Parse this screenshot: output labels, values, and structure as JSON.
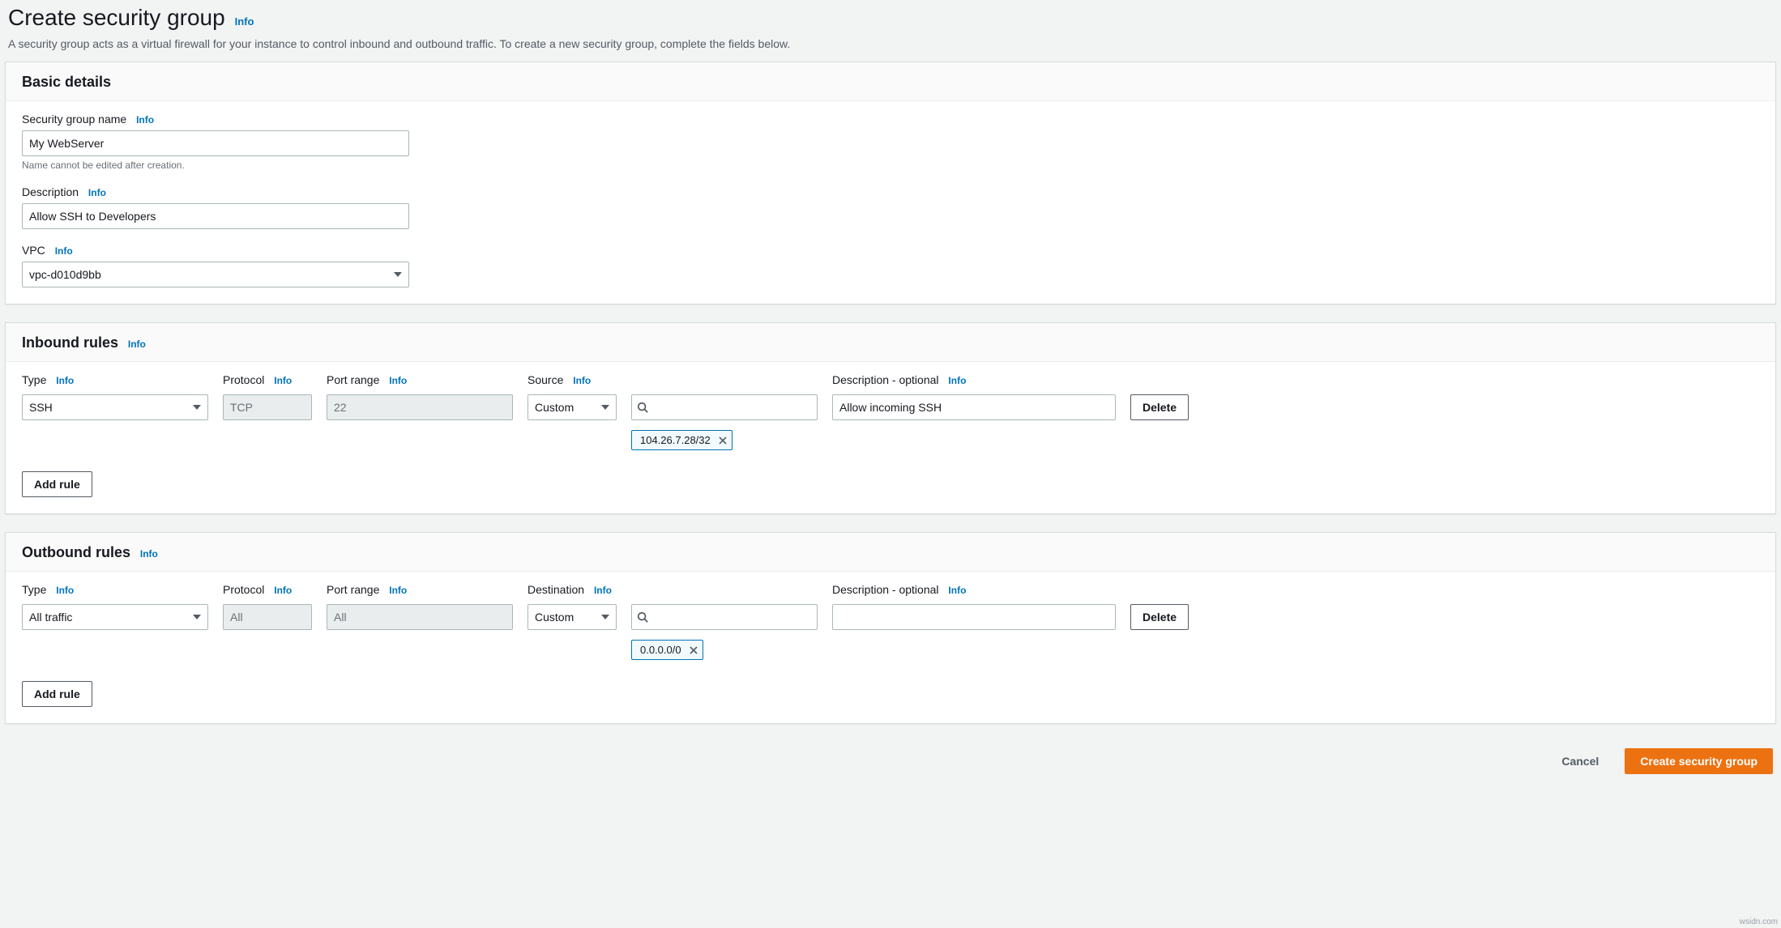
{
  "header": {
    "title": "Create security group",
    "info": "Info",
    "subtitle": "A security group acts as a virtual firewall for your instance to control inbound and outbound traffic. To create a new security group, complete the fields below."
  },
  "basic": {
    "panel_title": "Basic details",
    "name_label": "Security group name",
    "name_info": "Info",
    "name_value": "My WebServer",
    "name_hint": "Name cannot be edited after creation.",
    "desc_label": "Description",
    "desc_info": "Info",
    "desc_value": "Allow SSH to Developers",
    "vpc_label": "VPC",
    "vpc_info": "Info",
    "vpc_value": "vpc-d010d9bb"
  },
  "inbound": {
    "panel_title": "Inbound rules",
    "info": "Info",
    "headers": {
      "type": "Type",
      "type_info": "Info",
      "protocol": "Protocol",
      "protocol_info": "Info",
      "port": "Port range",
      "port_info": "Info",
      "source": "Source",
      "source_info": "Info",
      "desc": "Description - optional",
      "desc_info": "Info"
    },
    "rule": {
      "type": "SSH",
      "protocol": "TCP",
      "port": "22",
      "source_mode": "Custom",
      "source_chip": "104.26.7.28/32",
      "description": "Allow incoming SSH",
      "delete": "Delete"
    },
    "add_rule": "Add rule"
  },
  "outbound": {
    "panel_title": "Outbound rules",
    "info": "Info",
    "headers": {
      "type": "Type",
      "type_info": "Info",
      "protocol": "Protocol",
      "protocol_info": "Info",
      "port": "Port range",
      "port_info": "Info",
      "dest": "Destination",
      "dest_info": "Info",
      "desc": "Description - optional",
      "desc_info": "Info"
    },
    "rule": {
      "type": "All traffic",
      "protocol": "All",
      "port": "All",
      "dest_mode": "Custom",
      "dest_chip": "0.0.0.0/0",
      "description": "",
      "delete": "Delete"
    },
    "add_rule": "Add rule"
  },
  "footer": {
    "cancel": "Cancel",
    "submit": "Create security group"
  },
  "watermark": "wsidn.com"
}
